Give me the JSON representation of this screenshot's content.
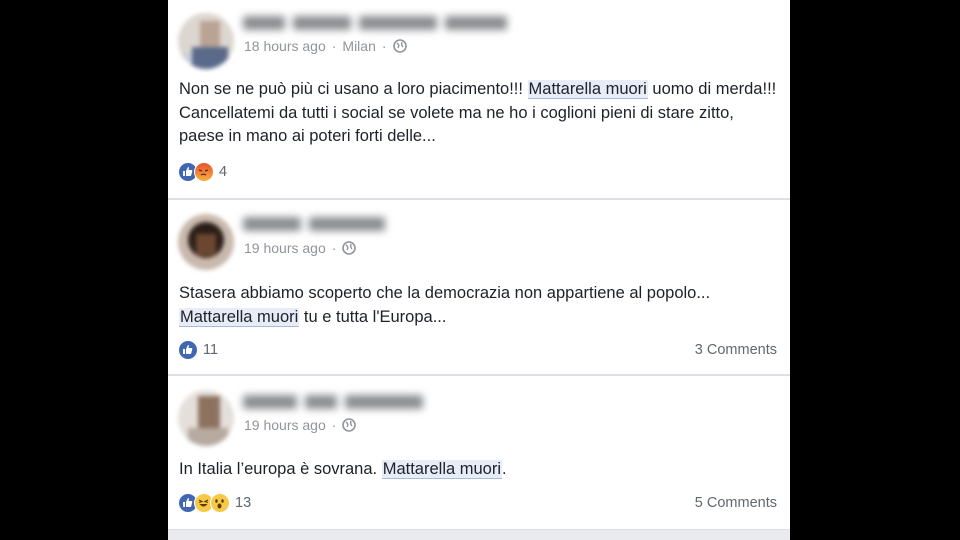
{
  "posts": [
    {
      "time": "18 hours ago",
      "separator": "·",
      "location": "Milan",
      "text_before": "Non se ne può più ci usano a loro piacimento!!! ",
      "highlight": "Mattarella muori",
      "text_after": " uomo di merda!!! Cancellatemi da tutti i social se volete ma ne ho i coglioni pieni di stare zitto, paese in mano ai poteri forti delle...",
      "reactions": [
        "like-icon",
        "angry-icon"
      ],
      "reaction_count": "4",
      "comments": ""
    },
    {
      "time": "19 hours ago",
      "separator": "·",
      "location": "",
      "text_before": "Stasera abbiamo scoperto che la democrazia non appartiene al popolo... ",
      "highlight": "Mattarella muori",
      "text_after": " tu e tutta l'Europa...",
      "reactions": [
        "like-icon"
      ],
      "reaction_count": "11",
      "comments": "3 Comments"
    },
    {
      "time": "19 hours ago",
      "separator": "·",
      "location": "",
      "text_before": "In Italia l’europa è sovrana. ",
      "highlight": "Mattarella muori",
      "text_after": ".",
      "reactions": [
        "like-icon",
        "haha-icon",
        "wow-icon"
      ],
      "reaction_count": "13",
      "comments": "5 Comments"
    }
  ],
  "colors": {
    "like": "#4267b2",
    "highlight_bg": "#e7ecf7",
    "meta_text": "#90949c"
  }
}
